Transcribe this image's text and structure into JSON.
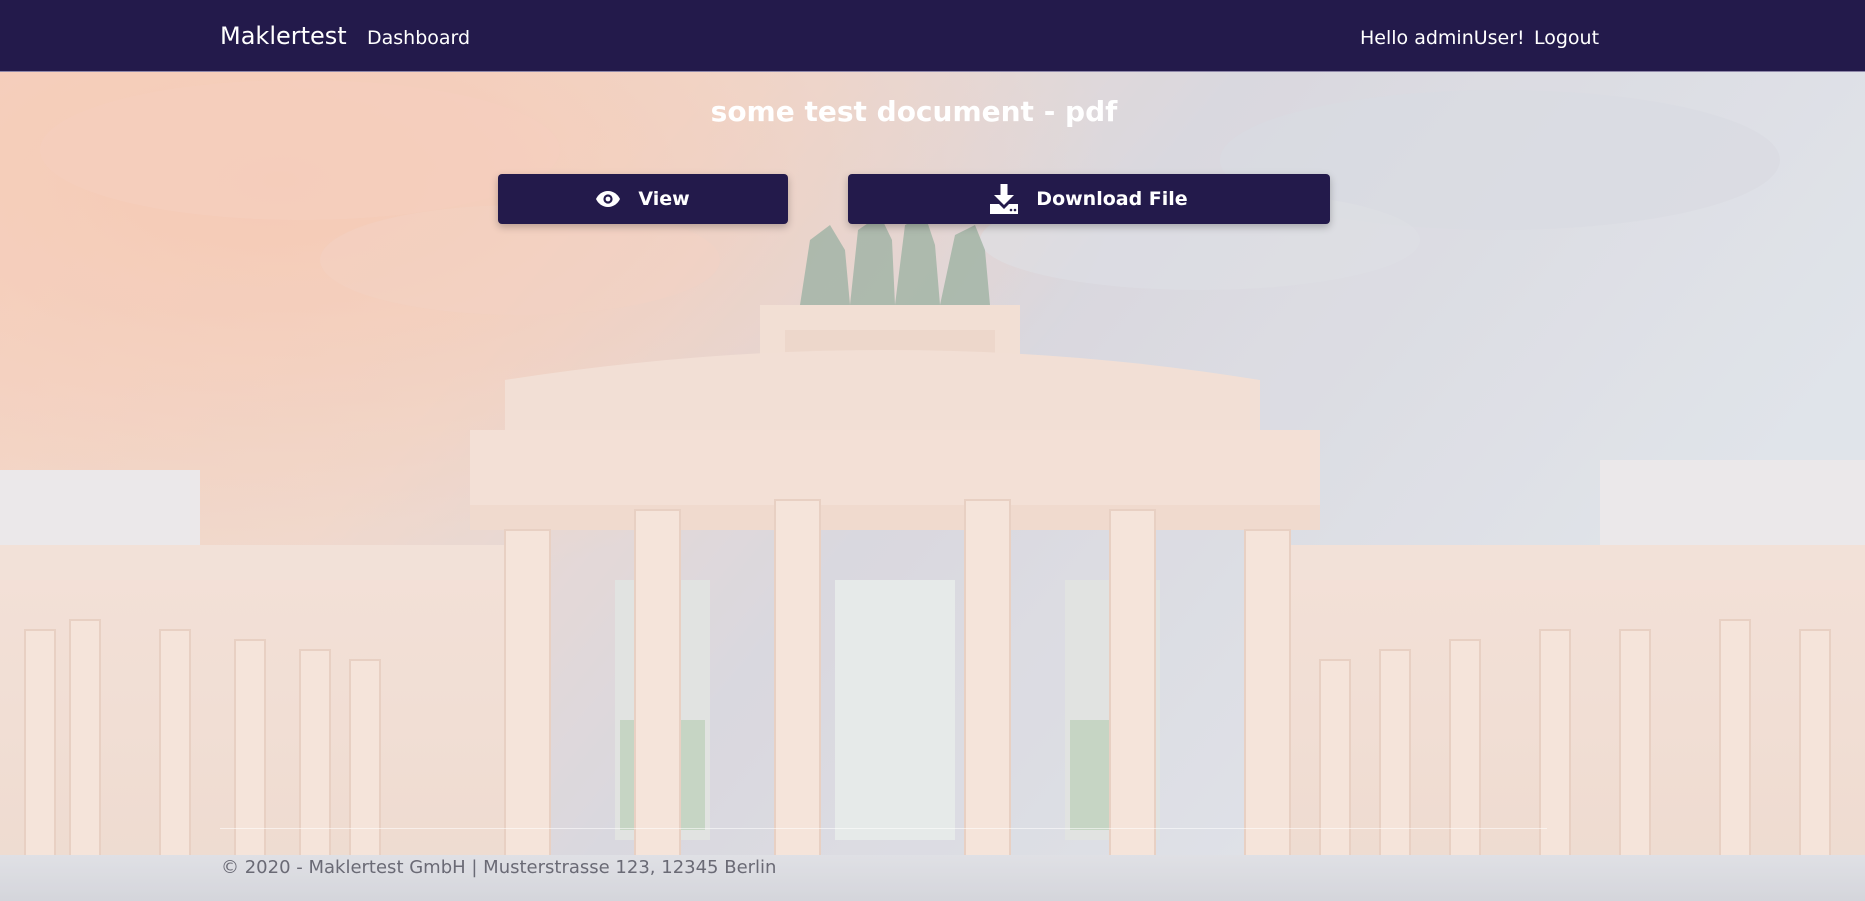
{
  "navbar": {
    "brand": "Maklertest",
    "links": {
      "dashboard": "Dashboard"
    },
    "greeting": "Hello adminUser!",
    "logout": "Logout",
    "background_color": "#231a4b"
  },
  "document": {
    "title": "some test document - pdf"
  },
  "actions": {
    "view_label": "View",
    "view_icon": "eye-icon",
    "download_label": "Download File",
    "download_icon": "download-icon",
    "button_color": "#231a4b"
  },
  "footer": {
    "text": "© 2020 - Maklertest GmbH | Musterstrasse 123, 12345 Berlin"
  }
}
